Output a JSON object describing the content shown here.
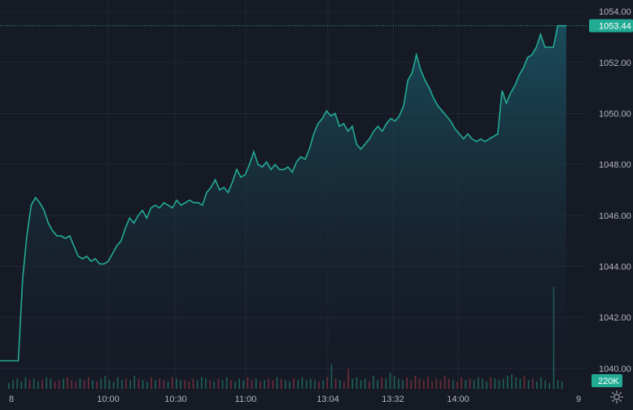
{
  "chart_data": {
    "type": "area",
    "title": "",
    "xlabel": "",
    "ylabel": "",
    "y_range": [
      1039.2,
      1054.45
    ],
    "y_ticks": [
      1040,
      1042,
      1044,
      1046,
      1048,
      1050,
      1052,
      1054
    ],
    "y_tick_labels": [
      "1040.00",
      "1042.00",
      "1044.00",
      "1046.00",
      "1048.00",
      "1050.00",
      "1052.00",
      "1054.00"
    ],
    "x_tick_labels": [
      "8",
      "10:00",
      "10:30",
      "11:00",
      "13:04",
      "13:32",
      "14:00",
      "9"
    ],
    "last_price": 1053.44,
    "last_price_label": "1053.44",
    "volume_label": "220K",
    "colors": {
      "line": "#22ab94",
      "area_top": "#1b5566",
      "area_bottom": "#161a25",
      "background": "#161a25",
      "grid": "#232734",
      "volume_up": "#1f6b5f",
      "volume_down": "#7a2f3c",
      "badge": "#22ab94"
    },
    "series": [
      {
        "values": [
          1040.3,
          1040.3,
          1040.3,
          1043.5,
          1045.2,
          1046.4,
          1046.7,
          1046.5,
          1046.2,
          1045.7,
          1045.4,
          1045.2,
          1045.2,
          1045.1,
          1045.2,
          1044.8,
          1044.4,
          1044.3,
          1044.4,
          1044.2,
          1044.3,
          1044.1,
          1044.1,
          1044.2,
          1044.5,
          1044.8,
          1045.0,
          1045.5,
          1045.9,
          1045.7,
          1046.0,
          1046.2,
          1045.9,
          1046.3,
          1046.4,
          1046.3,
          1046.5,
          1046.4,
          1046.3,
          1046.6,
          1046.4,
          1046.5,
          1046.6,
          1046.5,
          1046.5,
          1046.4,
          1046.9,
          1047.1,
          1047.4,
          1047.0,
          1047.1,
          1046.9,
          1047.3,
          1047.8,
          1047.5,
          1047.6,
          1048.0,
          1048.5,
          1048.0,
          1047.9,
          1048.1,
          1047.8,
          1048.0,
          1047.8,
          1047.8,
          1047.9,
          1047.7,
          1048.1,
          1048.3,
          1048.2,
          1048.6,
          1049.2,
          1049.6,
          1049.8,
          1050.1,
          1049.9,
          1050.0,
          1049.5,
          1049.6,
          1049.3,
          1049.5,
          1048.8,
          1048.6,
          1048.8,
          1049.0,
          1049.3,
          1049.5,
          1049.3,
          1049.6,
          1049.8,
          1049.7,
          1049.9,
          1050.3,
          1051.3,
          1051.6,
          1052.3,
          1051.7,
          1051.3,
          1051.0,
          1050.6,
          1050.3,
          1050.1,
          1049.9,
          1049.7,
          1049.4,
          1049.2,
          1049.0,
          1049.2,
          1049.0,
          1048.9,
          1049.0,
          1048.9,
          1049.0,
          1049.1,
          1049.2,
          1050.9,
          1050.4,
          1050.8,
          1051.1,
          1051.5,
          1051.8,
          1052.2,
          1052.3,
          1052.6,
          1053.1,
          1052.6,
          1052.6,
          1052.6,
          1053.44,
          1053.44,
          1053.44
        ]
      }
    ],
    "volume": [
      4,
      6,
      7,
      5,
      8,
      6,
      7,
      5,
      6,
      8,
      7,
      5,
      6,
      7,
      8,
      6,
      5,
      7,
      6,
      8,
      6,
      5,
      7,
      9,
      6,
      5,
      8,
      6,
      7,
      6,
      9,
      7,
      6,
      5,
      8,
      6,
      7,
      6,
      5,
      8,
      7,
      6,
      6,
      5,
      7,
      6,
      8,
      7,
      6,
      5,
      7,
      6,
      8,
      6,
      5,
      7,
      6,
      8,
      6,
      7,
      5,
      6,
      7,
      6,
      8,
      7,
      6,
      5,
      7,
      6,
      8,
      6,
      7,
      6,
      5,
      6,
      8,
      17,
      7,
      6,
      5,
      14,
      7,
      8,
      6,
      7,
      5,
      9,
      6,
      8,
      7,
      11,
      9,
      7,
      6,
      8,
      6,
      9,
      7,
      6,
      8,
      5,
      7,
      6,
      9,
      7,
      6,
      5,
      8,
      6,
      7,
      6,
      8,
      7,
      5,
      8,
      7,
      6,
      7,
      9,
      10,
      8,
      7,
      9,
      6,
      7,
      5,
      8,
      6,
      4,
      70,
      6,
      5
    ],
    "volume_direction": [
      1,
      1,
      1,
      1,
      1,
      0,
      1,
      1,
      0,
      1,
      1,
      0,
      0,
      1,
      0,
      0,
      0,
      1,
      0,
      0,
      1,
      0,
      1,
      1,
      1,
      1,
      1,
      1,
      0,
      1,
      1,
      0,
      1,
      1,
      0,
      1,
      0,
      0,
      1,
      0,
      1,
      1,
      0,
      0,
      0,
      1,
      1,
      1,
      0,
      1,
      0,
      1,
      1,
      0,
      1,
      1,
      1,
      0,
      0,
      1,
      0,
      1,
      0,
      0,
      1,
      0,
      1,
      1,
      0,
      1,
      1,
      1,
      1,
      1,
      0,
      1,
      0,
      1,
      0,
      1,
      0,
      0,
      1,
      1,
      1,
      1,
      0,
      1,
      1,
      0,
      1,
      1,
      1,
      1,
      1,
      0,
      0,
      0,
      0,
      0,
      0,
      0,
      0,
      0,
      0,
      0,
      1,
      0,
      0,
      1,
      0,
      1,
      1,
      1,
      1,
      0,
      1,
      1,
      1,
      1,
      1,
      1,
      1,
      0,
      1,
      0,
      1,
      1,
      1,
      1,
      1,
      1,
      1
    ]
  }
}
